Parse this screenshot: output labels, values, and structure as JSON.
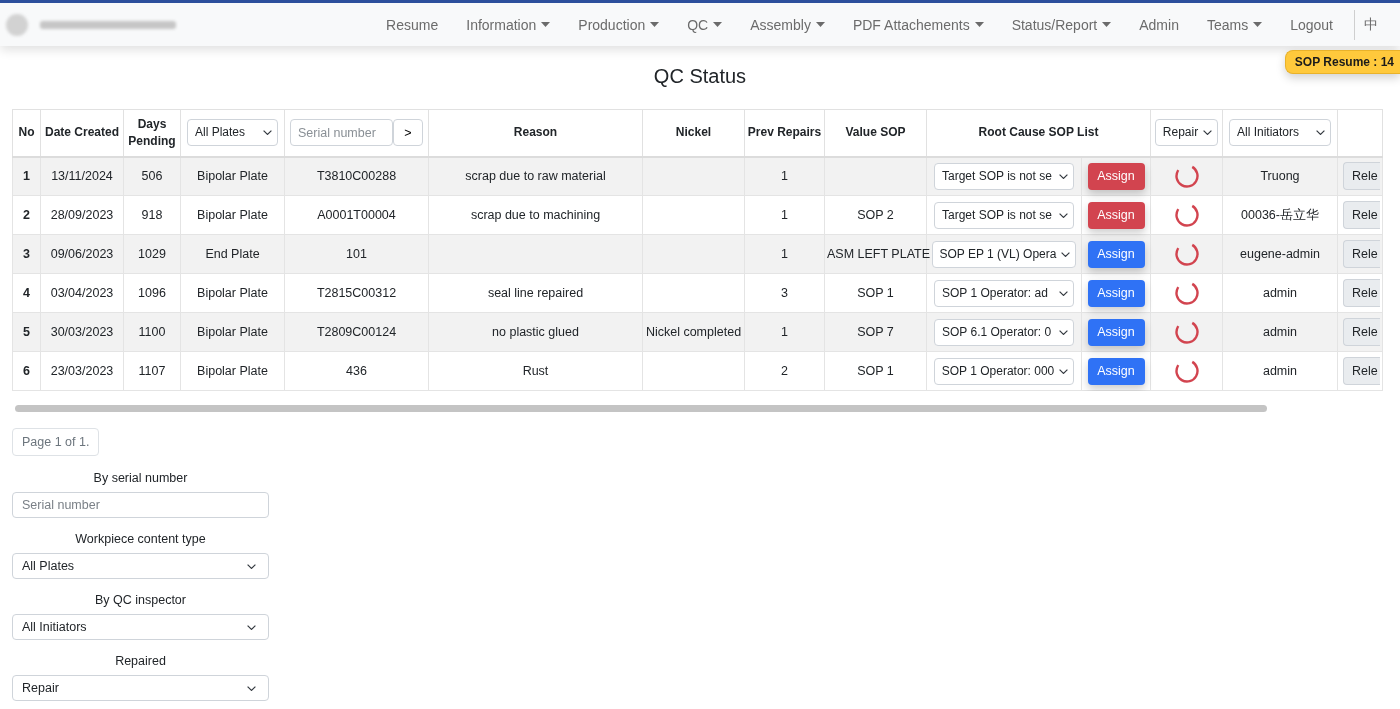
{
  "navbar": {
    "items": [
      {
        "label": "Resume",
        "dropdown": false
      },
      {
        "label": "Information",
        "dropdown": true
      },
      {
        "label": "Production",
        "dropdown": true
      },
      {
        "label": "QC",
        "dropdown": true
      },
      {
        "label": "Assembly",
        "dropdown": true
      },
      {
        "label": "PDF Attachements",
        "dropdown": true
      },
      {
        "label": "Status/Report",
        "dropdown": true
      },
      {
        "label": "Admin",
        "dropdown": false
      },
      {
        "label": "Teams",
        "dropdown": true
      },
      {
        "label": "Logout",
        "dropdown": false
      }
    ],
    "language": "中"
  },
  "badge": "SOP Resume : 14",
  "title": "QC Status",
  "table": {
    "columns": [
      {
        "kind": "text",
        "label": "No"
      },
      {
        "kind": "text",
        "label": "Date Created"
      },
      {
        "kind": "text",
        "label": "Days Pending"
      },
      {
        "kind": "select",
        "value": "All Plates"
      },
      {
        "kind": "search",
        "placeholder": "Serial number",
        "button": ">"
      },
      {
        "kind": "text",
        "label": "Reason"
      },
      {
        "kind": "text",
        "label": "Nickel"
      },
      {
        "kind": "text",
        "label": "Prev Repairs"
      },
      {
        "kind": "text",
        "label": "Value SOP"
      },
      {
        "kind": "group",
        "label": "Root Cause SOP List"
      },
      {
        "kind": "select",
        "value": "Repair"
      },
      {
        "kind": "select",
        "value": "All Initiators"
      },
      {
        "kind": "blank"
      }
    ],
    "rows": [
      {
        "no": "1",
        "date_created": "13/11/2024",
        "days_pending": "506",
        "type": "Bipolar Plate",
        "serial": "T3810C00288",
        "reason": "scrap due to raw material",
        "prev_repairs": "1",
        "root_cause": "Target SOP is not se",
        "assign": {
          "label": "Assign",
          "kind": "danger"
        },
        "initiator": "Truong",
        "release": "Rele"
      },
      {
        "no": "2",
        "date_created": "28/09/2023",
        "days_pending": "918",
        "type": "Bipolar Plate",
        "serial": "A0001T00004",
        "reason": "scrap due to machining",
        "prev_repairs": "1",
        "value_sop": "SOP 2",
        "root_cause": "Target SOP is not se",
        "assign": {
          "label": "Assign",
          "kind": "danger"
        },
        "initiator": "00036-岳立华",
        "release": "Rele"
      },
      {
        "no": "3",
        "date_created": "09/06/2023",
        "days_pending": "1029",
        "type": "End Plate",
        "serial": "101",
        "prev_repairs": "1",
        "value_sop": "ASM LEFT PLATE",
        "root_cause": "SOP EP 1 (VL) Opera",
        "assign": {
          "label": "Assign",
          "kind": "primary"
        },
        "initiator": "eugene-admin",
        "release": "Rele"
      },
      {
        "no": "4",
        "date_created": "03/04/2023",
        "days_pending": "1096",
        "type": "Bipolar Plate",
        "serial": "T2815C00312",
        "reason": "seal line repaired",
        "prev_repairs": "3",
        "value_sop": "SOP 1",
        "root_cause": "SOP 1 Operator: ad",
        "assign": {
          "label": "Assign",
          "kind": "primary"
        },
        "initiator": "admin",
        "release": "Rele"
      },
      {
        "no": "5",
        "date_created": "30/03/2023",
        "days_pending": "1100",
        "type": "Bipolar Plate",
        "serial": "T2809C00124",
        "reason": "no plastic glued",
        "nickel": "Nickel completed",
        "prev_repairs": "1",
        "value_sop": "SOP 7",
        "root_cause": "SOP 6.1 Operator: 0",
        "assign": {
          "label": "Assign",
          "kind": "primary"
        },
        "initiator": "admin",
        "release": "Rele"
      },
      {
        "no": "6",
        "date_created": "23/03/2023",
        "days_pending": "1107",
        "type": "Bipolar Plate",
        "serial": "436",
        "reason": "Rust",
        "prev_repairs": "2",
        "value_sop": "SOP 1",
        "root_cause": "SOP 1 Operator: 000",
        "assign": {
          "label": "Assign",
          "kind": "primary"
        },
        "initiator": "admin",
        "release": "Rele"
      }
    ]
  },
  "pagination": "Page 1 of 1.",
  "filters": [
    {
      "kind": "input",
      "label": "By serial number",
      "placeholder": "Serial number"
    },
    {
      "kind": "select",
      "label": "Workpiece content type",
      "value": "All Plates"
    },
    {
      "kind": "select",
      "label": "By QC inspector",
      "value": "All Initiators"
    },
    {
      "kind": "select",
      "label": "Repaired",
      "value": "Repair"
    }
  ]
}
